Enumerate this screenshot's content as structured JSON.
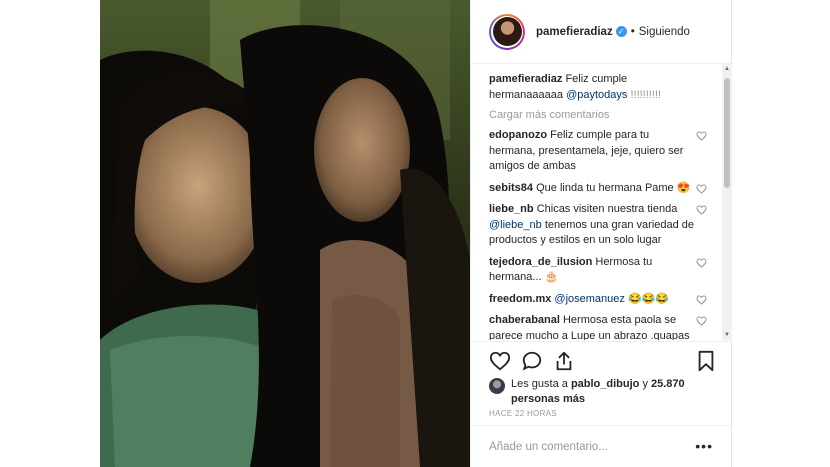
{
  "post": {
    "username": "pamefieradiaz",
    "follow_status": "Siguiendo",
    "dot": "•",
    "verified_glyph": "✓"
  },
  "caption": {
    "username": "pamefieradiaz",
    "text": "Feliz cumple hermanaaaaaa",
    "mention": "@paytodays",
    "suffix": "!!!!!!!!!!"
  },
  "load_more_label": "Cargar más comentarios",
  "comments": [
    {
      "username": "edopanozo",
      "text": "Feliz cumple para tu hermana, presentamela, jeje, quiero ser amigos de ambas"
    },
    {
      "username": "sebits84",
      "text": "Que linda tu hermana Pame 😍"
    },
    {
      "username": "liebe_nb",
      "text": "Chicas visiten nuestra tienda",
      "mention": "@liebe_nb",
      "text2": "tenemos una gran variedad de productos y estilos en un solo lugar"
    },
    {
      "username": "tejedora_de_ilusion",
      "text": "Hermosa tu hermana... 🎂"
    },
    {
      "username": "freedom.mx",
      "mention": "@josemanuez",
      "text": "😂😂😂"
    },
    {
      "username": "chaberabanal",
      "text": "Hermosa esta paola se parece mucho a Lupe un abrazo .guapas hermanas."
    }
  ],
  "likes": {
    "prefix": "Les gusta a",
    "user": "pablo_dibujo",
    "connector": "y",
    "count": "25.870 personas más"
  },
  "time_ago": "HACE 22 HORAS",
  "add_comment": {
    "placeholder": "Añade un comentario...",
    "more_label": "•••"
  },
  "icons": [
    "heart-icon",
    "comment-icon",
    "share-icon",
    "bookmark-icon",
    "verified-badge-icon"
  ],
  "colors": {
    "mention": "#003569",
    "muted": "#999999",
    "verified": "#3897f0",
    "text": "#262626"
  }
}
